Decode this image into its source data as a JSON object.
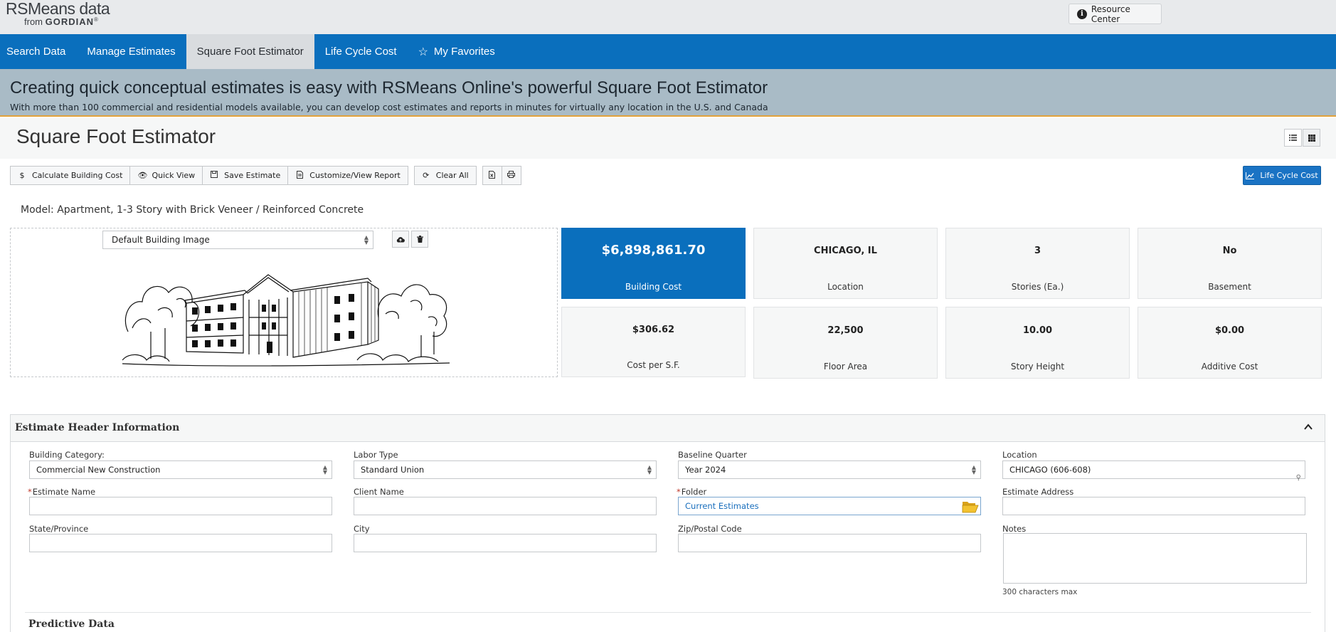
{
  "header": {
    "logo_main": "RSMeans data",
    "logo_from": "from",
    "logo_brand": "GORDIAN",
    "resource_center": "Resource Center"
  },
  "nav": {
    "items": [
      "Search Data",
      "Manage Estimates",
      "Square Foot Estimator",
      "Life Cycle Cost",
      "My Favorites"
    ],
    "active": "Square Foot Estimator"
  },
  "banner": {
    "title": "Creating quick conceptual estimates is easy with RSMeans Online's powerful Square Foot Estimator",
    "subtitle": "With more than 100 commercial and residential models available, you can develop cost estimates and reports in minutes for virtually any location in the U.S. and Canada"
  },
  "page": {
    "title": "Square Foot Estimator"
  },
  "toolbar": {
    "calculate": "Calculate Building Cost",
    "quick_view": "Quick View",
    "save": "Save Estimate",
    "report": "Customize/View Report",
    "clear": "Clear All",
    "life_cycle": "Life Cycle Cost"
  },
  "model": {
    "line": "Model: Apartment, 1-3 Story with Brick Veneer / Reinforced Concrete"
  },
  "image_panel": {
    "selected": "Default Building Image"
  },
  "stats": {
    "building_cost": {
      "value": "$6,898,861.70",
      "label": "Building Cost"
    },
    "location": {
      "value": "CHICAGO, IL",
      "label": "Location"
    },
    "stories": {
      "value": "3",
      "label": "Stories (Ea.)"
    },
    "basement": {
      "value": "No",
      "label": "Basement"
    },
    "cost_per_sf": {
      "value": "$306.62",
      "label": "Cost per S.F."
    },
    "floor_area": {
      "value": "22,500",
      "label": "Floor Area"
    },
    "story_height": {
      "value": "10.00",
      "label": "Story Height"
    },
    "additive_cost": {
      "value": "$0.00",
      "label": "Additive Cost"
    }
  },
  "estimate_header": {
    "title": "Estimate Header Information",
    "building_category": {
      "label": "Building Category:",
      "value": "Commercial New Construction"
    },
    "labor_type": {
      "label": "Labor Type",
      "value": "Standard Union"
    },
    "baseline_quarter": {
      "label": "Baseline Quarter",
      "value": "Year 2024"
    },
    "location": {
      "label": "Location",
      "value": "CHICAGO (606-608)"
    },
    "estimate_name": {
      "label": "Estimate Name",
      "value": ""
    },
    "client_name": {
      "label": "Client Name",
      "value": ""
    },
    "folder": {
      "label": "Folder",
      "value": "Current Estimates"
    },
    "estimate_address": {
      "label": "Estimate Address",
      "value": ""
    },
    "state": {
      "label": "State/Province",
      "value": ""
    },
    "city": {
      "label": "City",
      "value": ""
    },
    "zip": {
      "label": "Zip/Postal Code",
      "value": ""
    },
    "notes": {
      "label": "Notes",
      "hint": "300 characters max"
    },
    "predictive": "Predictive Data"
  }
}
